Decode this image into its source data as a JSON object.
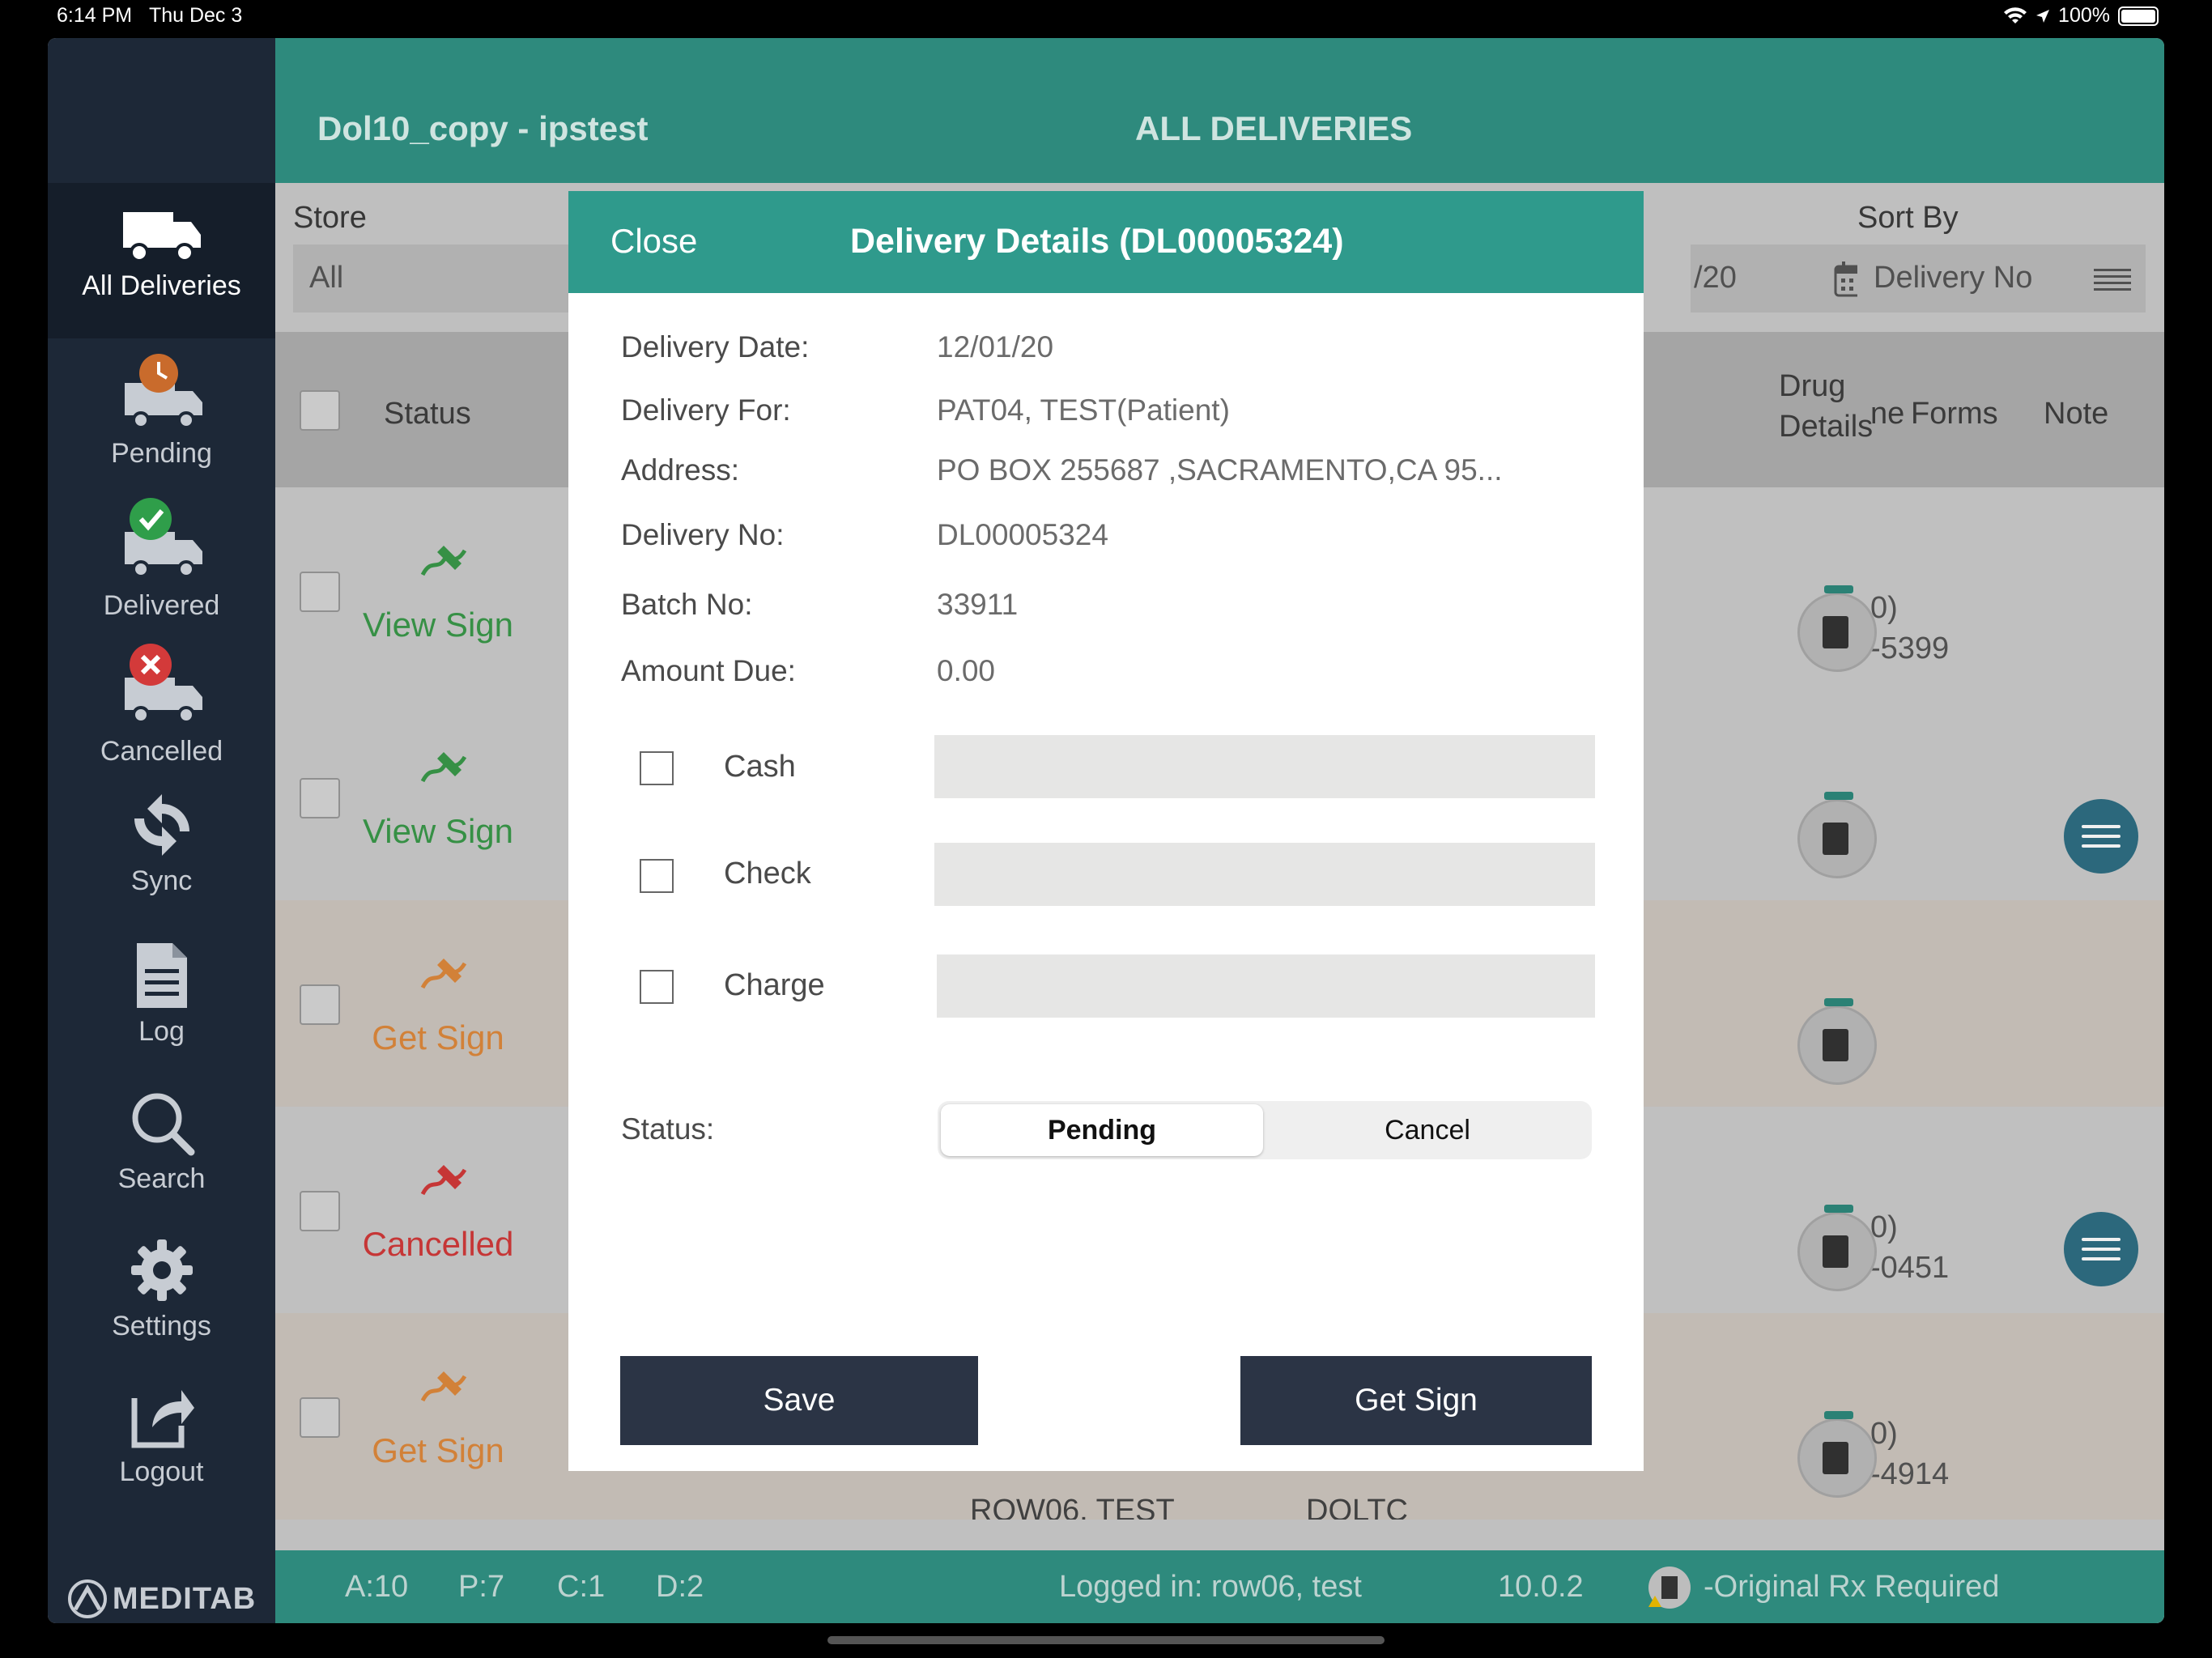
{
  "statusbar": {
    "time": "6:14 PM",
    "date": "Thu Dec 3",
    "battery": "100%"
  },
  "sidebar": {
    "items": [
      {
        "label": "All Deliveries"
      },
      {
        "label": "Pending"
      },
      {
        "label": "Delivered"
      },
      {
        "label": "Cancelled"
      },
      {
        "label": "Sync"
      },
      {
        "label": "Log"
      },
      {
        "label": "Search"
      },
      {
        "label": "Settings"
      },
      {
        "label": "Logout"
      }
    ],
    "logo": "MEDITAB"
  },
  "header": {
    "app_title": "Dol10_copy - ipstest",
    "page_title": "ALL DELIVERIES"
  },
  "filters": {
    "store_label": "Store",
    "store_value": "All",
    "date_partial": "/20",
    "sort_label": "Sort By",
    "sort_value": "Delivery No"
  },
  "columns": {
    "status": "Status",
    "phone_partial": "ne",
    "drug_details_1": "Drug",
    "drug_details_2": "Details",
    "forms": "Forms",
    "note": "Note"
  },
  "rows": [
    {
      "status": "View Sign",
      "phone1": "0)",
      "phone2": "-5399"
    },
    {
      "status": "View Sign",
      "phone1": "",
      "phone2": ""
    },
    {
      "status": "Get Sign",
      "phone1": "",
      "phone2": ""
    },
    {
      "status": "Cancelled",
      "phone1": "0)",
      "phone2": "-0451"
    },
    {
      "status": "Get Sign",
      "phone1": "0)",
      "phone2": "-4914"
    }
  ],
  "row_peek": {
    "name": "ROW06, TEST",
    "store": "DOLTC"
  },
  "footer": {
    "a": "A:10",
    "p": "P:7",
    "c": "C:1",
    "d": "D:2",
    "logged_in": "Logged in: row06, test",
    "version": "10.0.2",
    "legend": "-Original Rx Required"
  },
  "modal": {
    "close": "Close",
    "title": "Delivery Details (DL00005324)",
    "fields": [
      {
        "label": "Delivery Date:",
        "value": "12/01/20"
      },
      {
        "label": "Delivery For:",
        "value": "PAT04, TEST(Patient)"
      },
      {
        "label": "Address:",
        "value": "PO BOX 255687 ,SACRAMENTO,CA 95..."
      },
      {
        "label": "Delivery No:",
        "value": "DL00005324"
      },
      {
        "label": "Batch No:",
        "value": "33911"
      },
      {
        "label": "Amount Due:",
        "value": "0.00"
      }
    ],
    "payments": [
      {
        "label": "Cash"
      },
      {
        "label": "Check"
      },
      {
        "label": "Charge"
      }
    ],
    "status_label": "Status:",
    "status_options": [
      "Pending",
      "Cancel"
    ],
    "save": "Save",
    "get_sign": "Get Sign"
  },
  "colors": {
    "header": "#2e8a7d",
    "modal_header": "#2f9a8c",
    "sidebar": "#1d2837",
    "button": "#2b3445",
    "view_sign": "#3a9a4a",
    "get_sign": "#e08a3c",
    "cancelled": "#d33a3a"
  }
}
